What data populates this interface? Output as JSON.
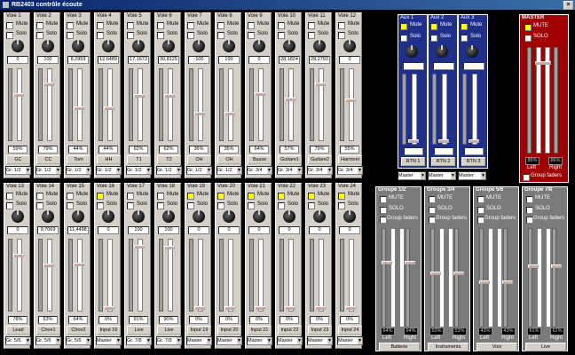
{
  "window": {
    "title": "RB2403 contrôle écoute",
    "close": "×"
  },
  "labels": {
    "mute": "Mute",
    "solo": "Solo",
    "mute_caps": "MUTE",
    "solo_caps": "SOLO",
    "group_faders": "Group faders",
    "left": "Left",
    "right": "Right",
    "arrow": "▼"
  },
  "channels_top": [
    {
      "name": "Voie 1",
      "value": "0",
      "pct": "59%",
      "label": "GC",
      "group": "Gr. 1/2",
      "fader": 0.63,
      "yellow": false
    },
    {
      "name": "Voie 2",
      "value": "100",
      "pct": "79%",
      "label": "CC",
      "group": "Gr. 1/2",
      "fader": 0.79,
      "yellow": false
    },
    {
      "name": "Voie 3",
      "value": "8,2959",
      "pct": "44%",
      "label": "Tom",
      "group": "Gr. 1/2",
      "fader": 0.44,
      "yellow": false
    },
    {
      "name": "Voie 4",
      "value": "12,6489",
      "pct": "44%",
      "label": "HH",
      "group": "Gr. 1/2",
      "fader": 0.44,
      "yellow": false
    },
    {
      "name": "Voie 5",
      "value": "17,1673",
      "pct": "62%",
      "label": "T1",
      "group": "Gr. 1/2",
      "fader": 0.62,
      "yellow": false
    },
    {
      "name": "Voie 6",
      "value": "30,8125",
      "pct": "62%",
      "label": "T2",
      "group": "Gr. 1/2",
      "fader": 0.62,
      "yellow": false
    },
    {
      "name": "Voie 7",
      "value": "-100",
      "pct": "36%",
      "label": "OH",
      "group": "Gr. 1/2",
      "fader": 0.36,
      "yellow": false
    },
    {
      "name": "Voie 8",
      "value": "100",
      "pct": "36%",
      "label": "OH",
      "group": "Gr. 1/2",
      "fader": 0.36,
      "yellow": false
    },
    {
      "name": "Voie 9",
      "value": "0",
      "pct": "64%",
      "label": "Basse",
      "group": "Gr. 3/4",
      "fader": 0.64,
      "yellow": false
    },
    {
      "name": "Voie 10",
      "value": "28,1824",
      "pct": "57%",
      "label": "Guitare1",
      "group": "Gr. 3/4",
      "fader": 0.57,
      "yellow": false
    },
    {
      "name": "Voie 11",
      "value": "28,2793",
      "pct": "79%",
      "label": "Guitare2",
      "group": "Gr. 3/4",
      "fader": 0.79,
      "yellow": false
    },
    {
      "name": "Voie 12",
      "value": "0",
      "pct": "55%",
      "label": "Harmoni",
      "group": "Gr. 3/4",
      "fader": 0.55,
      "yellow": false
    }
  ],
  "channels_bottom": [
    {
      "name": "Voie 13",
      "value": "0",
      "pct": "78%",
      "label": "Lead",
      "group": "Gr. 5/6",
      "fader": 0.78,
      "yellow": false
    },
    {
      "name": "Voie 14",
      "value": "9,7069",
      "pct": "63%",
      "label": "Choe1",
      "group": "Gr. 5/6",
      "fader": 0.63,
      "yellow": false
    },
    {
      "name": "Voie 15",
      "value": "11,4498",
      "pct": "64%",
      "label": "Choe2",
      "group": "Gr. 5/6",
      "fader": 0.64,
      "yellow": false
    },
    {
      "name": "Voie 16",
      "value": "0",
      "pct": "0%",
      "label": "Input 16",
      "group": "Master",
      "fader": 0.0,
      "yellow": true
    },
    {
      "name": "Voie 17",
      "value": "100",
      "pct": "91%",
      "label": "Live",
      "group": "Gr. 7/8",
      "fader": 0.91,
      "yellow": false
    },
    {
      "name": "Voie 18",
      "value": "100",
      "pct": "90%",
      "label": "Live",
      "group": "Gr. 7/8",
      "fader": 0.9,
      "yellow": false
    },
    {
      "name": "Voie 19",
      "value": "0",
      "pct": "0%",
      "label": "Input 19",
      "group": "Master",
      "fader": 0.0,
      "yellow": true
    },
    {
      "name": "Voie 20",
      "value": "0",
      "pct": "0%",
      "label": "Input 20",
      "group": "Master",
      "fader": 0.0,
      "yellow": true
    },
    {
      "name": "Voie 21",
      "value": "0",
      "pct": "0%",
      "label": "Input 21",
      "group": "Master",
      "fader": 0.0,
      "yellow": true
    },
    {
      "name": "Voie 22",
      "value": "0",
      "pct": "0%",
      "label": "Input 22",
      "group": "Master",
      "fader": 0.0,
      "yellow": true
    },
    {
      "name": "Voie 23",
      "value": "0",
      "pct": "0%",
      "label": "Input 23",
      "group": "Master",
      "fader": 0.0,
      "yellow": true
    },
    {
      "name": "Voie 24",
      "value": "0",
      "pct": "0%",
      "label": "Input 24",
      "group": "Master",
      "fader": 0.0,
      "yellow": true
    }
  ],
  "aux": [
    {
      "name": "Aux 1",
      "value": "0",
      "pct": "0%",
      "rtn": "RTN 1",
      "group": "Master"
    },
    {
      "name": "Aux 2",
      "value": "0",
      "pct": "0%",
      "rtn": "RTN 2",
      "group": "Master"
    },
    {
      "name": "Aux 3",
      "value": "0",
      "pct": "0%",
      "rtn": "RTN 3",
      "group": "Master"
    }
  ],
  "master": {
    "name": "MASTER",
    "pct_l": "86%",
    "pct_r": "86%",
    "fader": 0.86
  },
  "groups": [
    {
      "name": "Groupe 1/2",
      "pct_l": "64%",
      "pct_r": "64%",
      "btn": "Batterie",
      "fader": 0.64
    },
    {
      "name": "Groupe 3/4",
      "pct_l": "53%",
      "pct_r": "53%",
      "btn": "Instruments",
      "fader": 0.53
    },
    {
      "name": "Groupe 5/6",
      "pct_l": "43%",
      "pct_r": "43%",
      "btn": "Voix",
      "fader": 0.43
    },
    {
      "name": "Groupe 7/8",
      "pct_l": "61%",
      "pct_r": "61%",
      "btn": "Live",
      "fader": 0.61
    }
  ],
  "colors": {
    "aux_bg": "#1e2f8c",
    "master_bg": "#a00000",
    "group_bg": "#7a7a7a",
    "led_yellow": "#ffff00"
  }
}
